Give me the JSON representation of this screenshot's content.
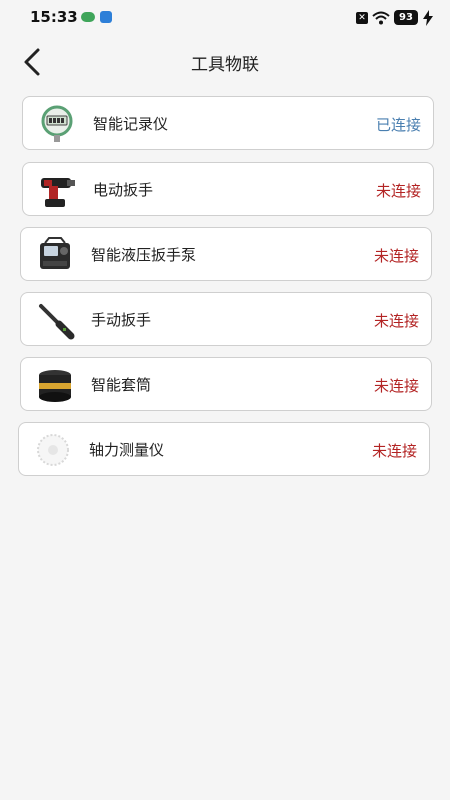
{
  "status_bar": {
    "time": "15:33",
    "battery": "93"
  },
  "header": {
    "title": "工具物联"
  },
  "tools": [
    {
      "name": "智能记录仪",
      "status": "已连接",
      "status_color": "#4a7fb0",
      "icon": "digital-gauge-icon"
    },
    {
      "name": "电动扳手",
      "status": "未连接",
      "status_color": "#b32424",
      "icon": "electric-wrench-icon"
    },
    {
      "name": "智能液压扳手泵",
      "status": "未连接",
      "status_color": "#b32424",
      "icon": "hydraulic-pump-icon"
    },
    {
      "name": "手动扳手",
      "status": "未连接",
      "status_color": "#b32424",
      "icon": "manual-wrench-icon"
    },
    {
      "name": "智能套筒",
      "status": "未连接",
      "status_color": "#b32424",
      "icon": "smart-socket-icon"
    },
    {
      "name": "轴力测量仪",
      "status": "未连接",
      "status_color": "#b32424",
      "icon": "axial-force-meter-icon"
    }
  ]
}
